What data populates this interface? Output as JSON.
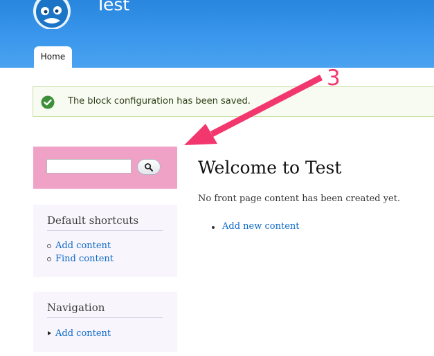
{
  "header": {
    "site_name": "Test",
    "logo_icon": "drupal-drop-icon",
    "tabs": [
      {
        "label": "Home"
      }
    ]
  },
  "status_message": {
    "icon": "check-circle-icon",
    "text": "The block configuration has been saved."
  },
  "search_block": {
    "input_value": "",
    "button_icon": "search-icon",
    "highlight_color": "#f0a2c6"
  },
  "shortcuts_block": {
    "title": "Default shortcuts",
    "items": [
      {
        "label": "Add content"
      },
      {
        "label": "Find content"
      }
    ]
  },
  "navigation_block": {
    "title": "Navigation",
    "items": [
      {
        "label": "Add content"
      }
    ]
  },
  "main": {
    "title": "Welcome to Test",
    "intro": "No front page content has been created yet.",
    "links": [
      {
        "label": "Add new content"
      }
    ]
  },
  "annotation": {
    "number": "3",
    "color": "#f2376e"
  },
  "colors": {
    "header": "#3a97ec",
    "link": "#0b69c7",
    "status_bg": "#f7fbf1"
  }
}
